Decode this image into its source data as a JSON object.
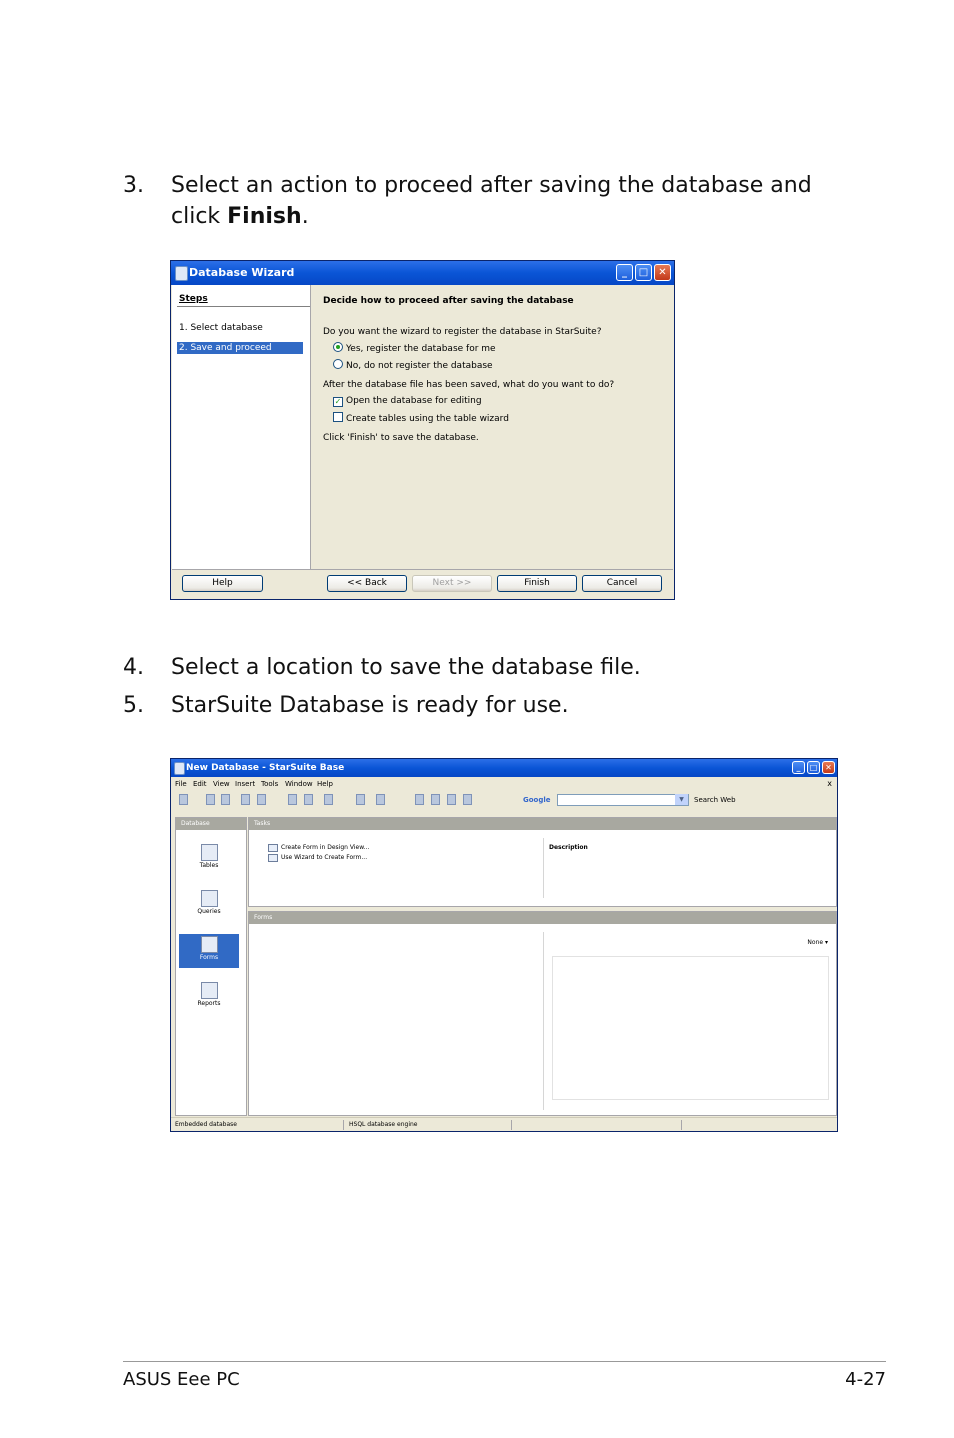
{
  "steps": [
    {
      "number": "3.",
      "text_before": "Select an action to proceed after saving the database and click ",
      "bold": "Finish",
      "text_after": "."
    },
    {
      "number": "4.",
      "text": "Select a location to save the database file."
    },
    {
      "number": "5.",
      "text": "StarSuite Database is ready for use."
    }
  ],
  "wizard": {
    "title": "Database Wizard",
    "steps_heading": "Steps",
    "step_items": [
      "1.  Select database",
      "2.  Save and proceed"
    ],
    "heading": "Decide how to proceed after saving the database",
    "question1": "Do you want the wizard to register the database in StarSuite?",
    "radio_yes": "Yes, register the database for me",
    "radio_no": "No, do not register the database",
    "question2": "After the database file has been saved, what do you want to do?",
    "check_open": "Open the database for editing",
    "check_create": "Create tables using the table wizard",
    "finish_note": "Click 'Finish' to save the database.",
    "buttons": {
      "help": "Help",
      "back": "<< Back",
      "next": "Next >>",
      "finish": "Finish",
      "cancel": "Cancel"
    }
  },
  "base": {
    "title": "New Database - StarSuite Base",
    "menu": [
      "File",
      "Edit",
      "View",
      "Insert",
      "Tools",
      "Window",
      "Help"
    ],
    "menu_close": "x",
    "google_label": "Google",
    "search_web": "Search Web",
    "database_heading": "Database",
    "db_items": [
      "Tables",
      "Queries",
      "Forms",
      "Reports"
    ],
    "tasks_heading": "Tasks",
    "task_items": [
      "Create Form in Design View...",
      "Use Wizard to Create Form..."
    ],
    "description_label": "Description",
    "forms_heading": "Forms",
    "none_label": "None",
    "status_left": "Embedded database",
    "status_mid": "HSQL database engine"
  },
  "footer": {
    "left": "ASUS Eee PC",
    "right": "4-27"
  }
}
